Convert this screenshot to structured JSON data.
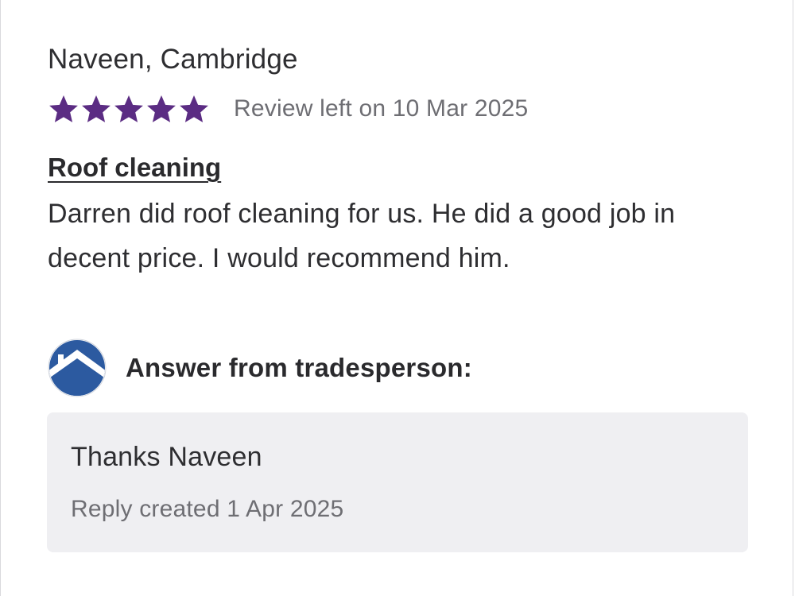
{
  "review": {
    "reviewer": "Naveen, Cambridge",
    "rating": 5,
    "rating_max": 5,
    "date_text": "Review left on 10 Mar 2025",
    "job_title": "Roof cleaning",
    "body": "Darren did roof cleaning for us. He did a good job in decent price. I would recommend him."
  },
  "answer": {
    "heading": "Answer from tradesperson:",
    "avatar_icon": "house-logo-icon",
    "reply_text": "Thanks Naveen",
    "reply_date": "Reply created 1 Apr 2025"
  },
  "colors": {
    "star": "#5b2c83",
    "logo_blue": "#2c5aa0",
    "reply_bg": "#efeff2",
    "muted_text": "#6e6e73"
  }
}
